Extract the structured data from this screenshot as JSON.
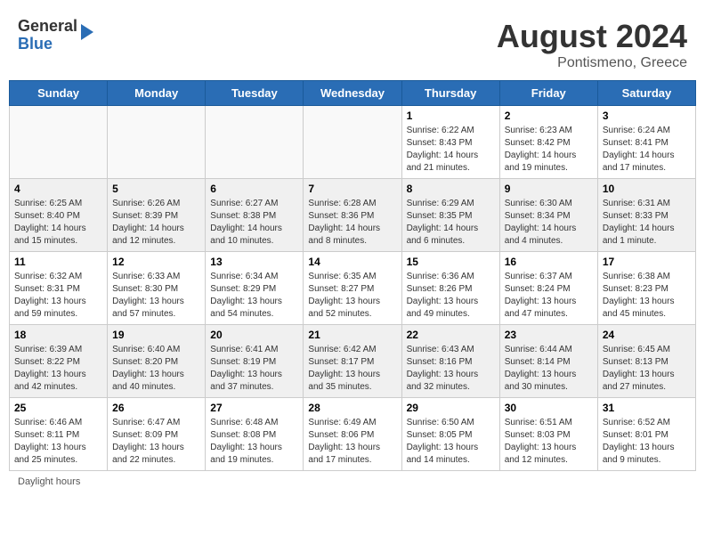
{
  "header": {
    "logo": {
      "general": "General",
      "blue": "Blue"
    },
    "month_year": "August 2024",
    "location": "Pontismeno, Greece"
  },
  "weekdays": [
    "Sunday",
    "Monday",
    "Tuesday",
    "Wednesday",
    "Thursday",
    "Friday",
    "Saturday"
  ],
  "weeks": [
    [
      {
        "day": "",
        "info": "",
        "empty": true
      },
      {
        "day": "",
        "info": "",
        "empty": true
      },
      {
        "day": "",
        "info": "",
        "empty": true
      },
      {
        "day": "",
        "info": "",
        "empty": true
      },
      {
        "day": "1",
        "info": "Sunrise: 6:22 AM\nSunset: 8:43 PM\nDaylight: 14 hours and 21 minutes.",
        "empty": false
      },
      {
        "day": "2",
        "info": "Sunrise: 6:23 AM\nSunset: 8:42 PM\nDaylight: 14 hours and 19 minutes.",
        "empty": false
      },
      {
        "day": "3",
        "info": "Sunrise: 6:24 AM\nSunset: 8:41 PM\nDaylight: 14 hours and 17 minutes.",
        "empty": false
      }
    ],
    [
      {
        "day": "4",
        "info": "Sunrise: 6:25 AM\nSunset: 8:40 PM\nDaylight: 14 hours and 15 minutes.",
        "empty": false,
        "shaded": true
      },
      {
        "day": "5",
        "info": "Sunrise: 6:26 AM\nSunset: 8:39 PM\nDaylight: 14 hours and 12 minutes.",
        "empty": false,
        "shaded": true
      },
      {
        "day": "6",
        "info": "Sunrise: 6:27 AM\nSunset: 8:38 PM\nDaylight: 14 hours and 10 minutes.",
        "empty": false,
        "shaded": true
      },
      {
        "day": "7",
        "info": "Sunrise: 6:28 AM\nSunset: 8:36 PM\nDaylight: 14 hours and 8 minutes.",
        "empty": false,
        "shaded": true
      },
      {
        "day": "8",
        "info": "Sunrise: 6:29 AM\nSunset: 8:35 PM\nDaylight: 14 hours and 6 minutes.",
        "empty": false,
        "shaded": true
      },
      {
        "day": "9",
        "info": "Sunrise: 6:30 AM\nSunset: 8:34 PM\nDaylight: 14 hours and 4 minutes.",
        "empty": false,
        "shaded": true
      },
      {
        "day": "10",
        "info": "Sunrise: 6:31 AM\nSunset: 8:33 PM\nDaylight: 14 hours and 1 minute.",
        "empty": false,
        "shaded": true
      }
    ],
    [
      {
        "day": "11",
        "info": "Sunrise: 6:32 AM\nSunset: 8:31 PM\nDaylight: 13 hours and 59 minutes.",
        "empty": false
      },
      {
        "day": "12",
        "info": "Sunrise: 6:33 AM\nSunset: 8:30 PM\nDaylight: 13 hours and 57 minutes.",
        "empty": false
      },
      {
        "day": "13",
        "info": "Sunrise: 6:34 AM\nSunset: 8:29 PM\nDaylight: 13 hours and 54 minutes.",
        "empty": false
      },
      {
        "day": "14",
        "info": "Sunrise: 6:35 AM\nSunset: 8:27 PM\nDaylight: 13 hours and 52 minutes.",
        "empty": false
      },
      {
        "day": "15",
        "info": "Sunrise: 6:36 AM\nSunset: 8:26 PM\nDaylight: 13 hours and 49 minutes.",
        "empty": false
      },
      {
        "day": "16",
        "info": "Sunrise: 6:37 AM\nSunset: 8:24 PM\nDaylight: 13 hours and 47 minutes.",
        "empty": false
      },
      {
        "day": "17",
        "info": "Sunrise: 6:38 AM\nSunset: 8:23 PM\nDaylight: 13 hours and 45 minutes.",
        "empty": false
      }
    ],
    [
      {
        "day": "18",
        "info": "Sunrise: 6:39 AM\nSunset: 8:22 PM\nDaylight: 13 hours and 42 minutes.",
        "empty": false,
        "shaded": true
      },
      {
        "day": "19",
        "info": "Sunrise: 6:40 AM\nSunset: 8:20 PM\nDaylight: 13 hours and 40 minutes.",
        "empty": false,
        "shaded": true
      },
      {
        "day": "20",
        "info": "Sunrise: 6:41 AM\nSunset: 8:19 PM\nDaylight: 13 hours and 37 minutes.",
        "empty": false,
        "shaded": true
      },
      {
        "day": "21",
        "info": "Sunrise: 6:42 AM\nSunset: 8:17 PM\nDaylight: 13 hours and 35 minutes.",
        "empty": false,
        "shaded": true
      },
      {
        "day": "22",
        "info": "Sunrise: 6:43 AM\nSunset: 8:16 PM\nDaylight: 13 hours and 32 minutes.",
        "empty": false,
        "shaded": true
      },
      {
        "day": "23",
        "info": "Sunrise: 6:44 AM\nSunset: 8:14 PM\nDaylight: 13 hours and 30 minutes.",
        "empty": false,
        "shaded": true
      },
      {
        "day": "24",
        "info": "Sunrise: 6:45 AM\nSunset: 8:13 PM\nDaylight: 13 hours and 27 minutes.",
        "empty": false,
        "shaded": true
      }
    ],
    [
      {
        "day": "25",
        "info": "Sunrise: 6:46 AM\nSunset: 8:11 PM\nDaylight: 13 hours and 25 minutes.",
        "empty": false
      },
      {
        "day": "26",
        "info": "Sunrise: 6:47 AM\nSunset: 8:09 PM\nDaylight: 13 hours and 22 minutes.",
        "empty": false
      },
      {
        "day": "27",
        "info": "Sunrise: 6:48 AM\nSunset: 8:08 PM\nDaylight: 13 hours and 19 minutes.",
        "empty": false
      },
      {
        "day": "28",
        "info": "Sunrise: 6:49 AM\nSunset: 8:06 PM\nDaylight: 13 hours and 17 minutes.",
        "empty": false
      },
      {
        "day": "29",
        "info": "Sunrise: 6:50 AM\nSunset: 8:05 PM\nDaylight: 13 hours and 14 minutes.",
        "empty": false
      },
      {
        "day": "30",
        "info": "Sunrise: 6:51 AM\nSunset: 8:03 PM\nDaylight: 13 hours and 12 minutes.",
        "empty": false
      },
      {
        "day": "31",
        "info": "Sunrise: 6:52 AM\nSunset: 8:01 PM\nDaylight: 13 hours and 9 minutes.",
        "empty": false
      }
    ]
  ],
  "footer": {
    "daylight_label": "Daylight hours"
  }
}
